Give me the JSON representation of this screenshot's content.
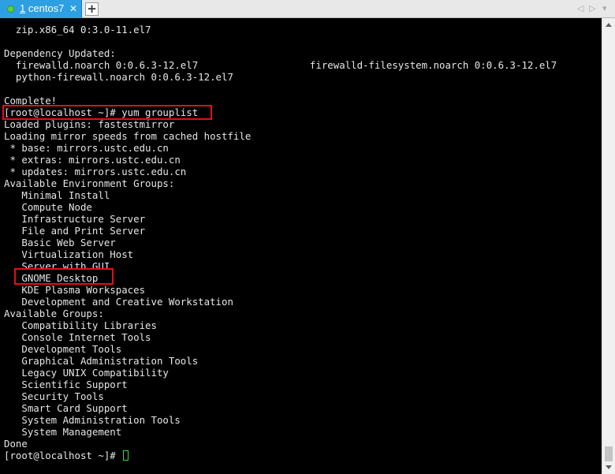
{
  "tab": {
    "number": "1",
    "title": "centos7",
    "close": "✕"
  },
  "add_tab": "+",
  "nav": {
    "prev": "◁",
    "next": "▷",
    "menu": "▾"
  },
  "terminal": {
    "lines": [
      "  zip.x86_64 0:3.0-11.el7",
      "",
      "Dependency Updated:",
      "  firewalld.noarch 0:0.6.3-12.el7                   firewalld-filesystem.noarch 0:0.6.3-12.el7",
      "  python-firewall.noarch 0:0.6.3-12.el7",
      "",
      "Complete!",
      "[root@localhost ~]# yum grouplist",
      "Loaded plugins: fastestmirror",
      "Loading mirror speeds from cached hostfile",
      " * base: mirrors.ustc.edu.cn",
      " * extras: mirrors.ustc.edu.cn",
      " * updates: mirrors.ustc.edu.cn",
      "Available Environment Groups:",
      "   Minimal Install",
      "   Compute Node",
      "   Infrastructure Server",
      "   File and Print Server",
      "   Basic Web Server",
      "   Virtualization Host",
      "   Server with GUI",
      "   GNOME Desktop",
      "   KDE Plasma Workspaces",
      "   Development and Creative Workstation",
      "Available Groups:",
      "   Compatibility Libraries",
      "   Console Internet Tools",
      "   Development Tools",
      "   Graphical Administration Tools",
      "   Legacy UNIX Compatibility",
      "   Scientific Support",
      "   Security Tools",
      "   Smart Card Support",
      "   System Administration Tools",
      "   System Management",
      "Done"
    ],
    "prompt": "[root@localhost ~]# "
  },
  "colors": {
    "tab_active": "#2d9fe3",
    "highlight": "#e0101a",
    "cursor": "#3ae03a",
    "text": "#e6e6e6"
  }
}
